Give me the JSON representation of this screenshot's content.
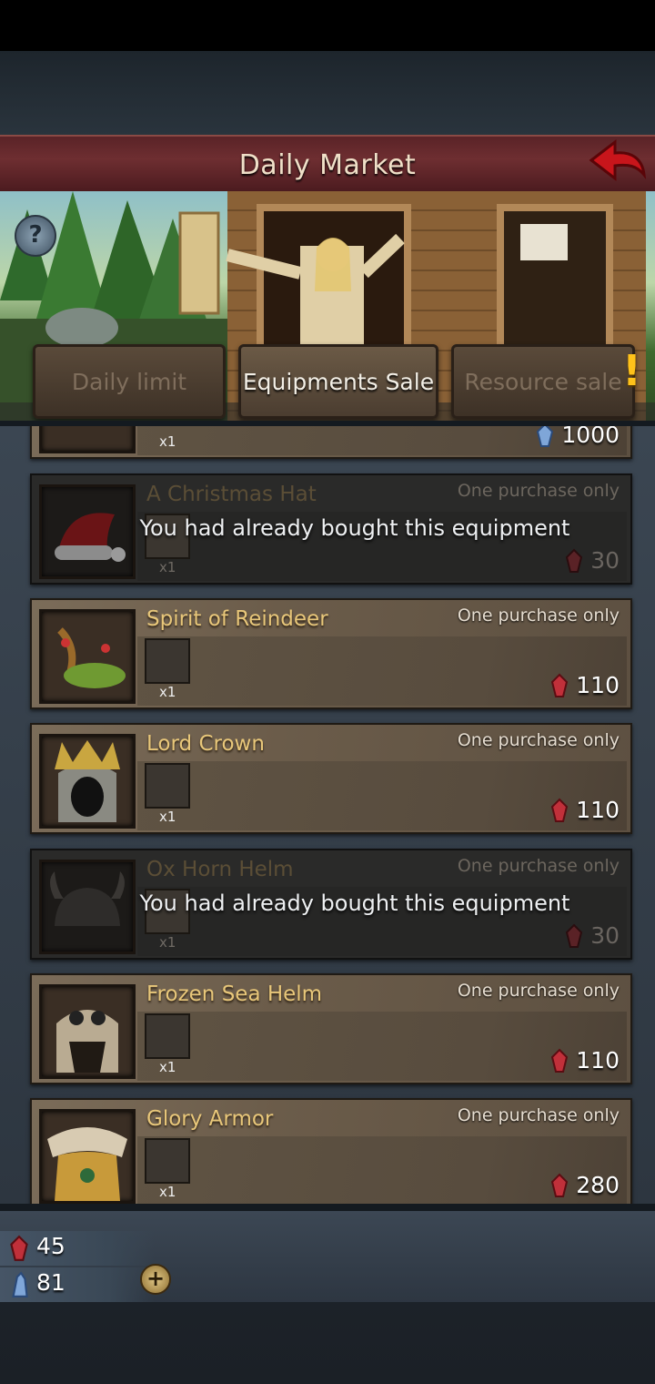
{
  "header": {
    "title": "Daily Market"
  },
  "help": {
    "label": "?"
  },
  "tabs": [
    {
      "label": "Daily limit",
      "active": false
    },
    {
      "label": "Equipments Sale",
      "active": true
    },
    {
      "label": "Resource sale",
      "active": false
    }
  ],
  "alert_mark": "!",
  "items": [
    {
      "name": "",
      "limit": "",
      "qty": "x1",
      "price": "1000",
      "currency": "crystal",
      "bought": false,
      "partial": true
    },
    {
      "name": "A Christmas Hat",
      "limit": "One purchase only",
      "qty": "x1",
      "price": "30",
      "currency": "ruby",
      "bought": true
    },
    {
      "name": "Spirit of Reindeer",
      "limit": "One purchase only",
      "qty": "x1",
      "price": "110",
      "currency": "ruby",
      "bought": false
    },
    {
      "name": "Lord Crown",
      "limit": "One purchase only",
      "qty": "x1",
      "price": "110",
      "currency": "ruby",
      "bought": false
    },
    {
      "name": "Ox Horn Helm",
      "limit": "One purchase only",
      "qty": "x1",
      "price": "30",
      "currency": "ruby",
      "bought": true
    },
    {
      "name": "Frozen Sea Helm",
      "limit": "One purchase only",
      "qty": "x1",
      "price": "110",
      "currency": "ruby",
      "bought": false
    },
    {
      "name": "Glory Armor",
      "limit": "One purchase only",
      "qty": "x1",
      "price": "280",
      "currency": "ruby",
      "bought": false
    }
  ],
  "bought_message": "You had already bought this equipment",
  "resources": {
    "ruby": "45",
    "crystal": "81",
    "add_label": "+"
  },
  "colors": {
    "title_bar": "#6e2e31",
    "gold_text": "#e8c77a",
    "ruby": "#c0303a",
    "crystal": "#7fa6d8"
  }
}
